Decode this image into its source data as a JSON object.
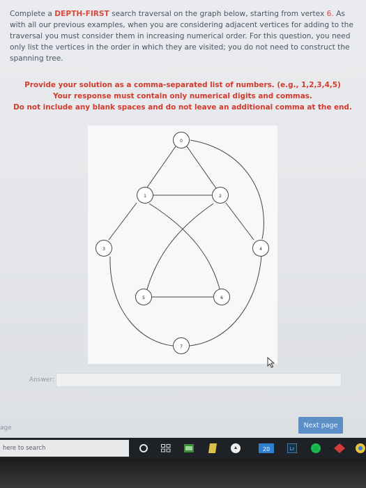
{
  "question": {
    "part1": "Complete a ",
    "dfs": "DEPTH-FIRST",
    "part2": " search traversal on the graph below, starting from vertex ",
    "start_vertex": "6.",
    "part3": " As with all our previous examples, when you are considering adjacent vertices for adding to the traversal you must consider them in increasing numerical order. For this question, you need only list the vertices in the order in which they are visited; you do not need to construct the spanning tree."
  },
  "instructions": [
    "Provide your solution as a comma-separated list of numbers. (e.g., 1,2,3,4,5)",
    "Your response must contain only numerical digits and commas.",
    "Do not include any blank spaces and do not leave an additional comma at the end."
  ],
  "graph": {
    "vertices": [
      "0",
      "1",
      "2",
      "3",
      "4",
      "5",
      "6",
      "7"
    ]
  },
  "answer": {
    "label": "Answer:",
    "value": ""
  },
  "page_label": "age",
  "next_button": "Next page",
  "taskbar": {
    "search_text": "here to search",
    "badge": "20"
  }
}
